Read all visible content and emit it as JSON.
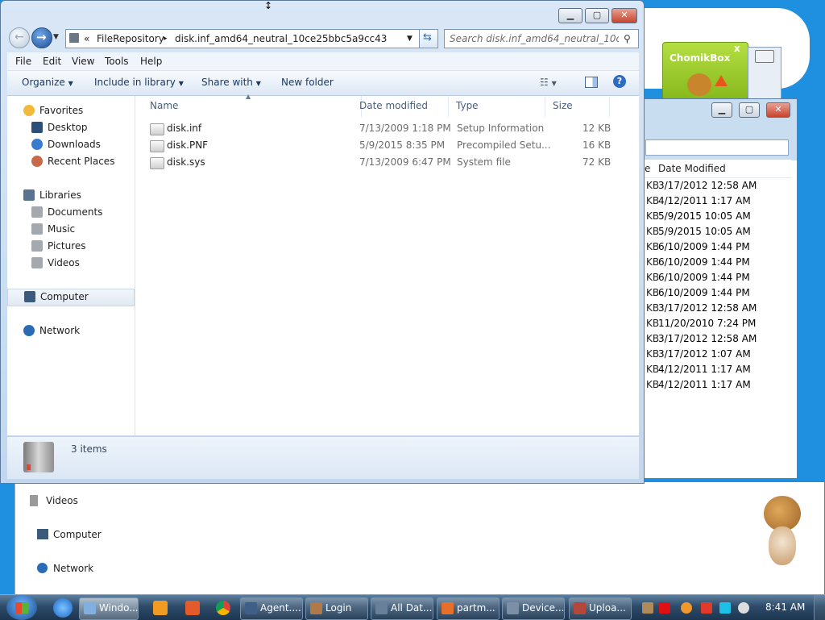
{
  "main_window": {
    "breadcrumb": {
      "chevron": "«",
      "parent": "FileRepository",
      "separator": "▸",
      "current": "disk.inf_amd64_neutral_10ce25bbc5a9cc43"
    },
    "search_placeholder": "Search disk.inf_amd64_neutral_10ce25...",
    "menu": [
      "File",
      "Edit",
      "View",
      "Tools",
      "Help"
    ],
    "commands": {
      "organize": "Organize",
      "include_in_library": "Include in library",
      "share_with": "Share with",
      "new_folder": "New folder"
    },
    "nav": {
      "favorites": "Favorites",
      "desktop": "Desktop",
      "downloads": "Downloads",
      "recent_places": "Recent Places",
      "libraries": "Libraries",
      "documents": "Documents",
      "music": "Music",
      "pictures": "Pictures",
      "videos": "Videos",
      "computer": "Computer",
      "network": "Network"
    },
    "columns": {
      "name": "Name",
      "date_modified": "Date modified",
      "type": "Type",
      "size": "Size"
    },
    "files": [
      {
        "name": "disk.inf",
        "date": "7/13/2009 1:18 PM",
        "type": "Setup Information",
        "size": "12 KB"
      },
      {
        "name": "disk.PNF",
        "date": "5/9/2015 8:35 PM",
        "type": "Precompiled Setu...",
        "size": "16 KB"
      },
      {
        "name": "disk.sys",
        "date": "7/13/2009 6:47 PM",
        "type": "System file",
        "size": "72 KB"
      }
    ],
    "status": "3 items",
    "controls": {
      "minimize": "▁",
      "maximize": "▢",
      "close": "✕"
    }
  },
  "background_window": {
    "column_header": "Date Modified",
    "column_stub": "e",
    "size_stub": "KB",
    "rows": [
      "3/17/2012 12:58 AM",
      "4/12/2011 1:17 AM",
      "5/9/2015 10:05 AM",
      "5/9/2015 10:05 AM",
      "6/10/2009 1:44 PM",
      "6/10/2009 1:44 PM",
      "6/10/2009 1:44 PM",
      "6/10/2009 1:44 PM",
      "3/17/2012 12:58 AM",
      "11/20/2010 7:24 PM",
      "3/17/2012 12:58 AM",
      "3/17/2012 1:07 AM",
      "4/12/2011 1:17 AM",
      "4/12/2011 1:17 AM"
    ],
    "nav": {
      "videos": "Videos",
      "computer": "Computer",
      "network": "Network"
    }
  },
  "chomikbox": {
    "title": "ChomikBox",
    "close": "x"
  },
  "taskbar": {
    "tasks": [
      "Windo...",
      "Agent....",
      "Login",
      "All Dat...",
      "partm...",
      "Device...",
      "Uploa..."
    ],
    "clock": "8:41 AM"
  },
  "colors": {
    "desktop": "#1f8fe0",
    "window_frame": "#c2d7ee",
    "chomik_green": "#9ccc2a",
    "taskbar": "#2d4b69"
  }
}
